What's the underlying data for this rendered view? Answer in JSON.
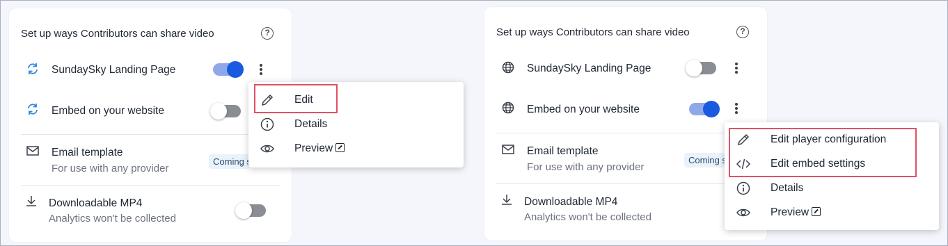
{
  "panels": [
    {
      "title": "Set up ways Contributors can share video",
      "rows": [
        {
          "label": "SundaySky Landing Page",
          "toggle": "on"
        },
        {
          "label": "Embed on your website",
          "toggle": "off"
        },
        {
          "label": "Email template",
          "sub": "For use with any provider",
          "badge": "Coming s"
        },
        {
          "label": "Downloadable MP4",
          "sub": "Analytics won't be collected",
          "toggle": "off"
        }
      ],
      "menu": [
        {
          "label": "Edit",
          "icon": "pencil-icon"
        },
        {
          "label": "Details",
          "icon": "info-icon"
        },
        {
          "label": "Preview",
          "icon": "eye-icon"
        }
      ]
    },
    {
      "title": "Set up ways Contributors can share video",
      "rows": [
        {
          "label": "SundaySky Landing Page",
          "toggle": "off"
        },
        {
          "label": "Embed on your website",
          "toggle": "on"
        },
        {
          "label": "Email template",
          "sub": "For use with any provider",
          "badge": "Coming s"
        },
        {
          "label": "Downloadable MP4",
          "sub": "Analytics won't be collected"
        }
      ],
      "menu": [
        {
          "label": "Edit player configuration",
          "icon": "pencil-icon"
        },
        {
          "label": "Edit embed settings",
          "icon": "code-icon"
        },
        {
          "label": "Details",
          "icon": "info-icon"
        },
        {
          "label": "Preview",
          "icon": "eye-icon"
        }
      ]
    }
  ],
  "colors": {
    "accent": "#1a5ae0",
    "highlight": "#e05263",
    "badge_bg": "#eaf2fb"
  }
}
